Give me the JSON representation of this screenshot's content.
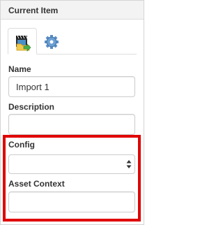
{
  "panel": {
    "title": "Current Item"
  },
  "tabs": [
    {
      "name": "import",
      "icon": "film-import-icon",
      "active": true
    },
    {
      "name": "settings",
      "icon": "gear-icon",
      "active": false
    }
  ],
  "fields": {
    "name": {
      "label": "Name",
      "value": "Import 1"
    },
    "description": {
      "label": "Description",
      "value": ""
    },
    "config": {
      "label": "Config",
      "value": ""
    },
    "asset_context": {
      "label": "Asset Context",
      "value": ""
    }
  },
  "colors": {
    "highlight": "#e00000",
    "header_bg": "#f3f3f3"
  }
}
